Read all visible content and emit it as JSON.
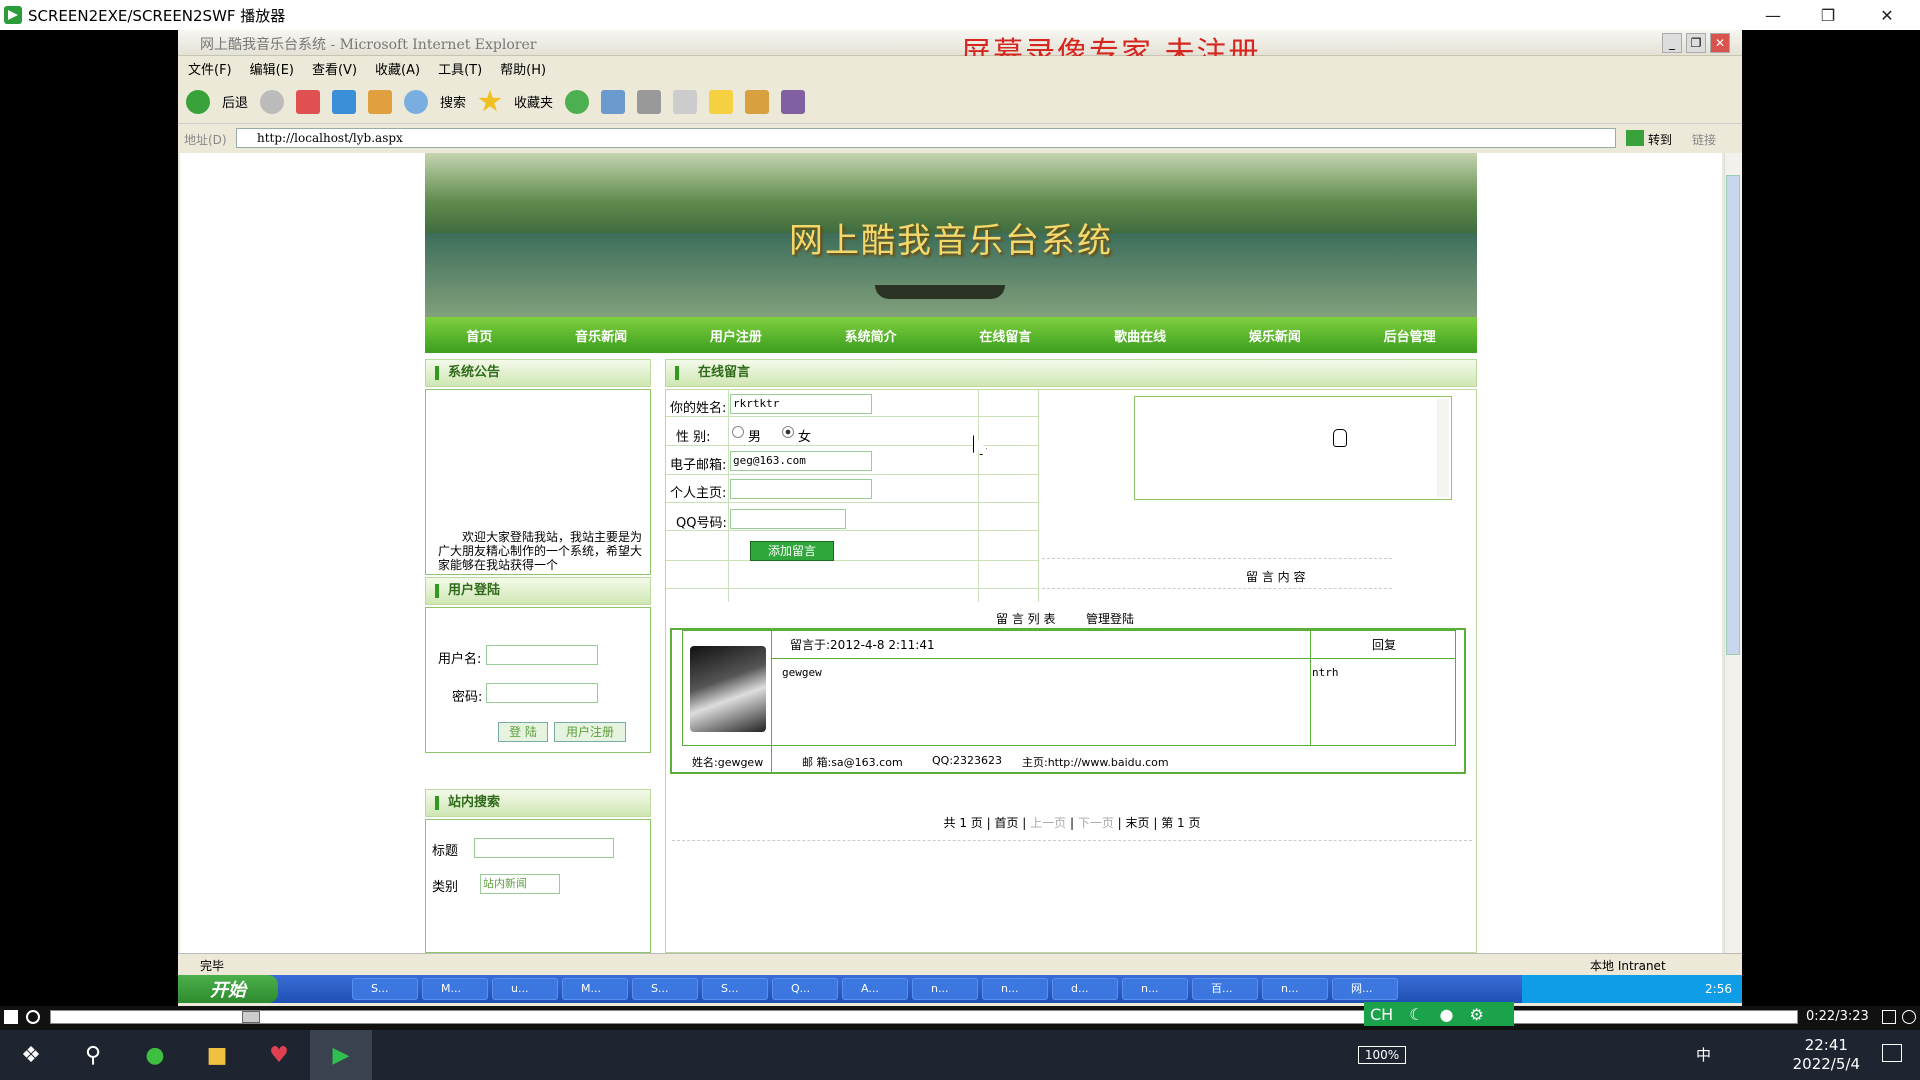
{
  "player": {
    "title": "SCREEN2EXE/SCREEN2SWF 播放器",
    "time": "0:22/3:23",
    "progress_fraction": 0.11
  },
  "ie": {
    "title": "网上酷我音乐台系统 - Microsoft Internet Explorer",
    "watermark": "屏幕录像专家  未注册",
    "menu": [
      "文件(F)",
      "编辑(E)",
      "查看(V)",
      "收藏(A)",
      "工具(T)",
      "帮助(H)"
    ],
    "toolbar": {
      "back": "后退",
      "search": "搜索",
      "favorites": "收藏夹"
    },
    "address_label": "地址(D)",
    "address": "http://localhost/lyb.aspx",
    "go": "转到",
    "links": "链接",
    "status_left": "完毕",
    "status_right": "本地 Intranet"
  },
  "site": {
    "banner_title": "网上酷我音乐台系统",
    "nav": [
      "首页",
      "音乐新闻",
      "用户注册",
      "系统简介",
      "在线留言",
      "歌曲在线",
      "娱乐新闻",
      "后台管理"
    ],
    "notice": {
      "title": "系统公告",
      "text": "欢迎大家登陆我站，我站主要是为广大朋友精心制作的一个系统，希望大家能够在我站获得一个"
    },
    "login": {
      "title": "用户登陆",
      "username_label": "用户名:",
      "password_label": "密码:",
      "login_button": "登 陆",
      "register_button": "用户注册"
    },
    "search": {
      "title": "站内搜索",
      "title_label": "标题",
      "category_label": "类别",
      "category_value": "站内新闻"
    },
    "guestbook": {
      "title": "在线留言",
      "name_label": "你的姓名:",
      "name_value": "rkrtktr",
      "gender_label": "性  别:",
      "gender_male": "男",
      "gender_female": "女",
      "gender_selected": "女",
      "email_label": "电子邮箱:",
      "email_value": "geg@163.com",
      "homepage_label": "个人主页:",
      "qq_label": "QQ号码:",
      "submit_button": "添加留言",
      "content_label": "留 言 内 容",
      "list_label": "留 言 列 表",
      "admin_login": "管理登陆"
    },
    "message": {
      "posted": "留言于:2012-4-8 2:11:41",
      "reply_header": "回复",
      "content": "gewgew",
      "reply": "ntrh",
      "name": "姓名:gewgew",
      "email": "邮 箱:sa@163.com",
      "qq": "QQ:2323623",
      "homepage": "主页:http://www.baidu.com"
    },
    "pager": {
      "total": "共 1 页",
      "first": "首页",
      "prev": "上一页",
      "next": "下一页",
      "last": "末页",
      "current": "第 1 页"
    }
  },
  "xp_taskbar": {
    "start": "开始",
    "tasks": [
      "S...",
      "M...",
      "u...",
      "M...",
      "S...",
      "S...",
      "Q...",
      "A...",
      "n...",
      "n...",
      "d...",
      "n...",
      "百...",
      "n...",
      "网..."
    ],
    "tray_time": "2:56"
  },
  "ime": {
    "label": "CH"
  },
  "windows": {
    "battery": "100%",
    "ime": "中",
    "time": "22:41",
    "date": "2022/5/4"
  }
}
